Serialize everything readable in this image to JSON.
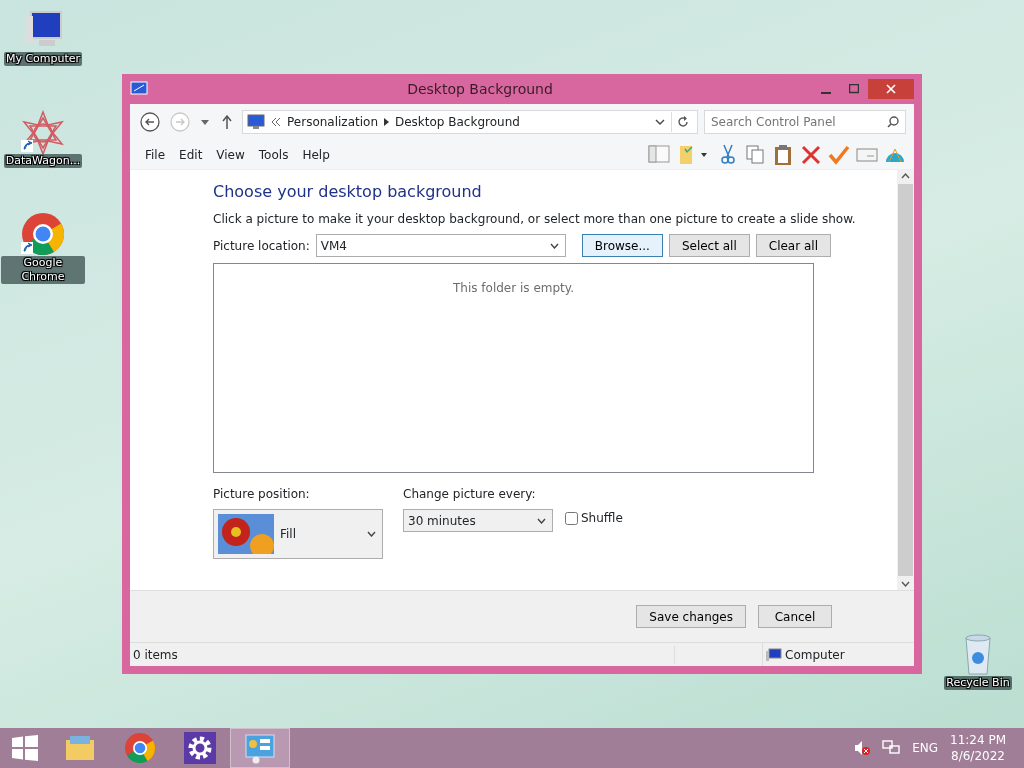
{
  "desktop_icons": [
    {
      "label": "My Computer",
      "kind": "computer",
      "shortcut": false
    },
    {
      "label": "DataWagon...",
      "kind": "star",
      "shortcut": true
    },
    {
      "label": "Google Chrome",
      "kind": "chrome",
      "shortcut": true
    }
  ],
  "recycle_bin": {
    "label": "Recycle Bin"
  },
  "window": {
    "title": "Desktop Background",
    "nav": {
      "back_disabled": false,
      "forward_disabled": true,
      "breadcrumb": [
        "Personalization",
        "Desktop Background"
      ],
      "search_placeholder": "Search Control Panel"
    },
    "menu": [
      "File",
      "Edit",
      "View",
      "Tools",
      "Help"
    ],
    "heading": "Choose your desktop background",
    "description": "Click a picture to make it your desktop background, or select more than one picture to create a slide show.",
    "picture_location": {
      "label": "Picture location:",
      "value": "VM4"
    },
    "buttons": [
      {
        "label": "Browse...",
        "focused": true
      },
      {
        "label": "Select all",
        "focused": false
      },
      {
        "label": "Clear all",
        "focused": false
      }
    ],
    "empty_text": "This folder is empty.",
    "position": {
      "label": "Picture position:",
      "value": "Fill"
    },
    "interval": {
      "label": "Change picture every:",
      "value": "30 minutes"
    },
    "shuffle": {
      "label": "Shuffle",
      "checked": false
    },
    "footer_buttons": [
      "Save changes",
      "Cancel"
    ],
    "status": {
      "items": "0 items",
      "zone": "Computer"
    }
  },
  "taskbar": {
    "items": [
      {
        "kind": "explorer",
        "selected": false
      },
      {
        "kind": "chrome",
        "selected": false
      },
      {
        "kind": "settings",
        "selected": false
      },
      {
        "kind": "control-panel",
        "selected": true
      }
    ],
    "language": "ENG",
    "time": "11:24 PM",
    "date": "8/6/2022"
  }
}
